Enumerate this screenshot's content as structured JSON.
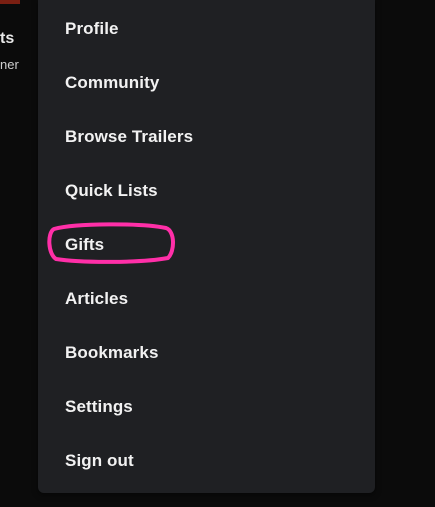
{
  "background_page": {
    "title_fragment": "ts",
    "subtitle_fragment": "ner"
  },
  "menu": {
    "items": [
      {
        "id": "profile",
        "label": "Profile"
      },
      {
        "id": "community",
        "label": "Community"
      },
      {
        "id": "browse-trailers",
        "label": "Browse Trailers"
      },
      {
        "id": "quick-lists",
        "label": "Quick Lists"
      },
      {
        "id": "gifts",
        "label": "Gifts",
        "annotated": true
      },
      {
        "id": "articles",
        "label": "Articles"
      },
      {
        "id": "bookmarks",
        "label": "Bookmarks"
      },
      {
        "id": "settings",
        "label": "Settings"
      },
      {
        "id": "sign-out",
        "label": "Sign out"
      }
    ]
  },
  "colors": {
    "menu_background": "#1f2023",
    "page_background": "#0b0b0b",
    "text": "#f2f2f2",
    "annotation": "#ff2fa8"
  }
}
